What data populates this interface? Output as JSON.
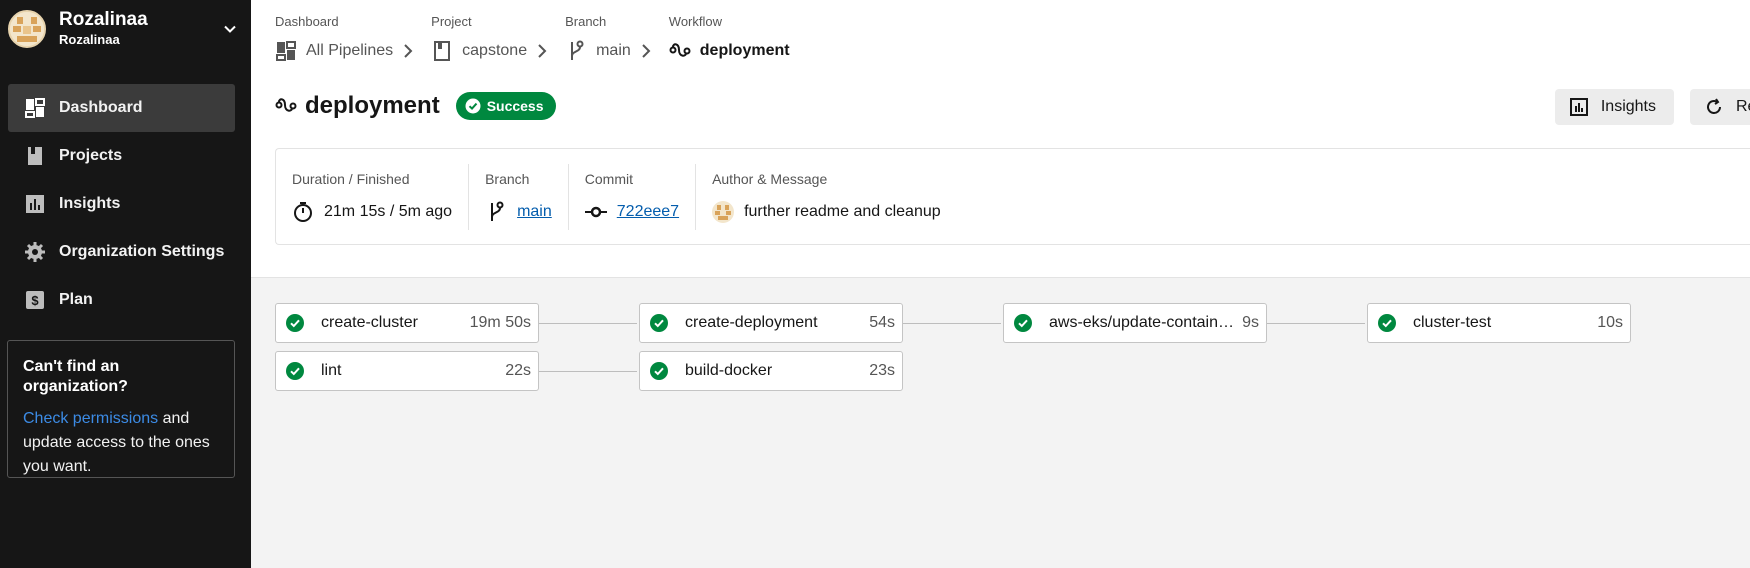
{
  "sidebar": {
    "org_name": "Rozalinaa",
    "org_sub": "Rozalinaa",
    "nav": [
      {
        "label": "Dashboard",
        "icon": "dashboard-icon",
        "active": true
      },
      {
        "label": "Projects",
        "icon": "projects-icon"
      },
      {
        "label": "Insights",
        "icon": "insights-icon"
      },
      {
        "label": "Organization Settings",
        "icon": "gear-icon"
      },
      {
        "label": "Plan",
        "icon": "plan-icon"
      }
    ],
    "org_card": {
      "title": "Can't find an organization?",
      "link": "Check permissions",
      "rest": " and update access to the ones you want."
    }
  },
  "breadcrumbs": [
    {
      "caption": "Dashboard",
      "label": "All Pipelines",
      "icon": "pipelines-icon"
    },
    {
      "caption": "Project",
      "label": "capstone",
      "icon": "project-icon"
    },
    {
      "caption": "Branch",
      "label": "main",
      "icon": "branch-icon"
    },
    {
      "caption": "Workflow",
      "label": "deployment",
      "icon": "workflow-icon"
    }
  ],
  "workflow": {
    "title": "deployment",
    "status": "Success"
  },
  "actions": {
    "insights": "Insights",
    "rerun": "Re"
  },
  "meta": {
    "duration_caption": "Duration / Finished",
    "duration_value": "21m 15s / 5m ago",
    "branch_caption": "Branch",
    "branch_value": "main",
    "commit_caption": "Commit",
    "commit_value": "722eee7",
    "author_caption": "Author & Message",
    "author_message": "further readme and cleanup"
  },
  "jobs": [
    {
      "name": "create-cluster",
      "duration": "19m 50s"
    },
    {
      "name": "create-deployment",
      "duration": "54s"
    },
    {
      "name": "aws-eks/update-container-image",
      "duration": "9s"
    },
    {
      "name": "cluster-test",
      "duration": "10s"
    },
    {
      "name": "lint",
      "duration": "22s"
    },
    {
      "name": "build-docker",
      "duration": "23s"
    }
  ],
  "colors": {
    "success": "#00883f",
    "sidebar_bg": "#161616",
    "link": "#045dad"
  }
}
